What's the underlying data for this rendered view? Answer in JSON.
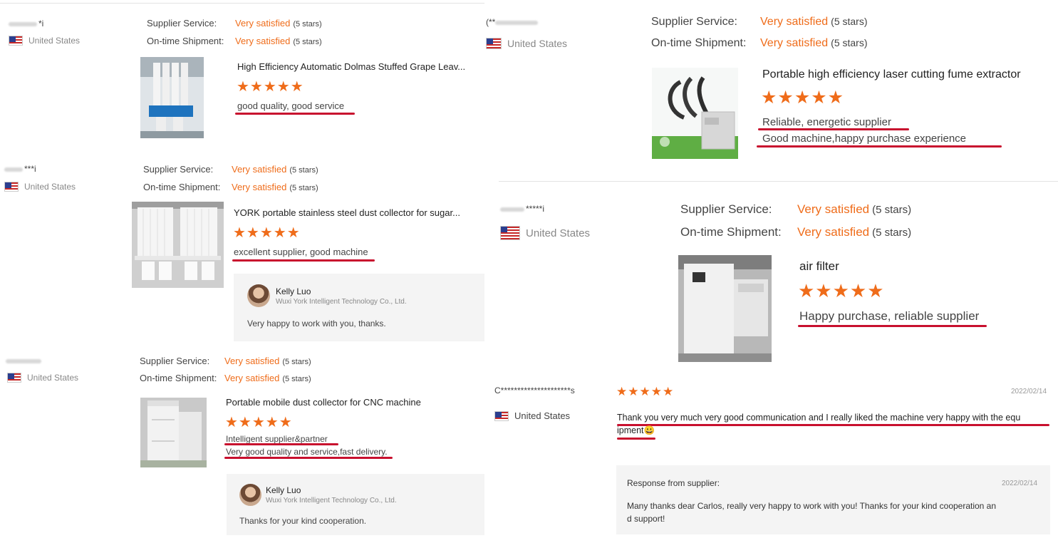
{
  "labels": {
    "supplier_service": "Supplier Service:",
    "ontime_shipment": "On-time Shipment:",
    "satisfied": "Very satisfied",
    "five_stars": "(5 stars)",
    "star_glyphs": "★★★★★"
  },
  "reviews": [
    {
      "buyer_suffix": "*i",
      "country": "United States",
      "product": "High Efficiency Automatic Dolmas Stuffed Grape Leav...",
      "comments": [
        "good quality, good service"
      ]
    },
    {
      "buyer_suffix": "***i",
      "country": "United States",
      "product": "YORK portable stainless steel dust collector for sugar...",
      "comments": [
        "excellent supplier, good machine"
      ],
      "reply": {
        "name": "Kelly Luo",
        "company": "Wuxi York Intelligent Technology Co., Ltd.",
        "message": "Very happy to work with you, thanks."
      }
    },
    {
      "buyer_suffix": "",
      "country": "United States",
      "product": "Portable mobile dust collector for CNC machine",
      "comments": [
        "Intelligent supplier&partner",
        "Very good quality and service,fast delivery."
      ],
      "reply": {
        "name": "Kelly Luo",
        "company": "Wuxi York Intelligent Technology Co., Ltd.",
        "message": "Thanks for your kind cooperation."
      }
    },
    {
      "buyer_suffix": "(**",
      "country": "United States",
      "product": "Portable high efficiency laser cutting fume extractor",
      "comments": [
        "Reliable, energetic supplier",
        "Good machine,happy purchase experience"
      ]
    },
    {
      "buyer_suffix": "*****i",
      "country": "United States",
      "product": "air filter",
      "comments": [
        "Happy purchase, reliable supplier"
      ]
    },
    {
      "buyer": "C*********************s",
      "country": "United States",
      "date": "2022/02/14",
      "comment_line1": "Thank you very much very good communication and I really liked the machine very happy with the equ",
      "comment_line2": "ipment😀",
      "response": {
        "label": "Response from supplier:",
        "date": "2022/02/14",
        "line1": "Many thanks dear Carlos, really very happy to work with you! Thanks for your kind cooperation an",
        "line2": "d support!"
      }
    }
  ],
  "colors": {
    "accent_orange": "#ef6c1a",
    "underline_red": "#c8102e"
  }
}
